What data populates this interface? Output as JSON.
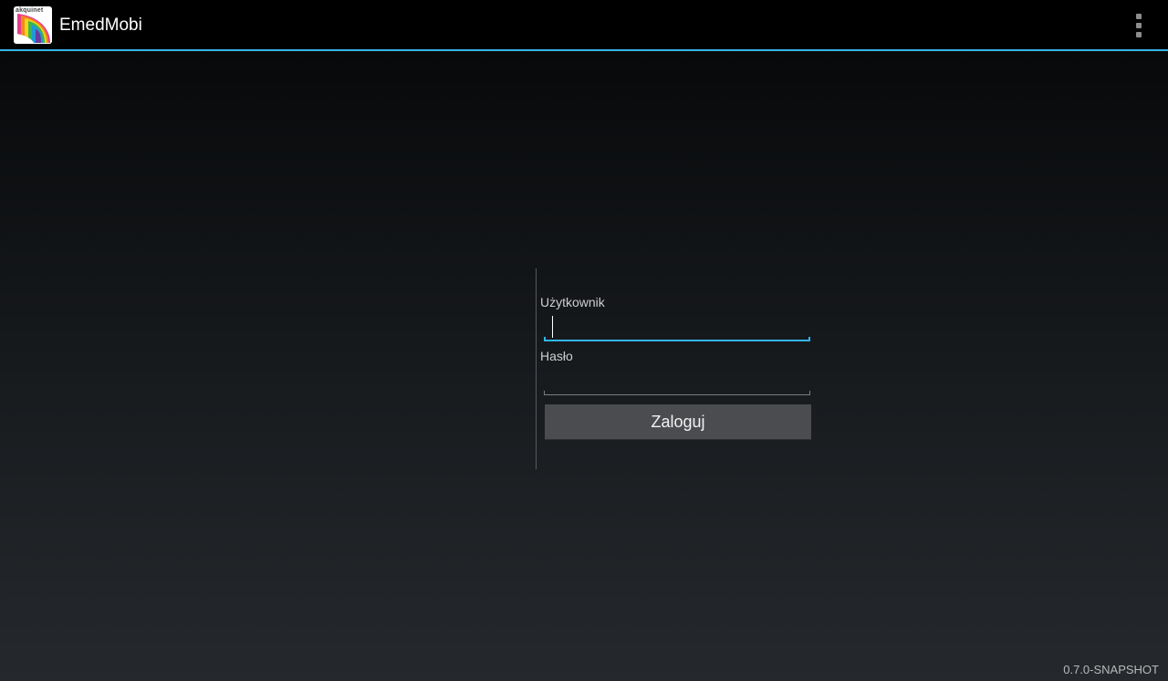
{
  "app": {
    "title": "EmedMobi",
    "icon": "app-logo-icon",
    "icon_brand_text": "akquinet"
  },
  "action_bar": {
    "overflow_icon": "overflow-menu-icon"
  },
  "login": {
    "username_label": "Użytkownik",
    "username_value": "",
    "password_label": "Hasło",
    "password_value": "",
    "submit_label": "Zaloguj"
  },
  "footer": {
    "version": "0.7.0-SNAPSHOT"
  },
  "colors": {
    "accent": "#33b5e5",
    "action_bar": "#000000",
    "button": "#4a4c4f"
  }
}
